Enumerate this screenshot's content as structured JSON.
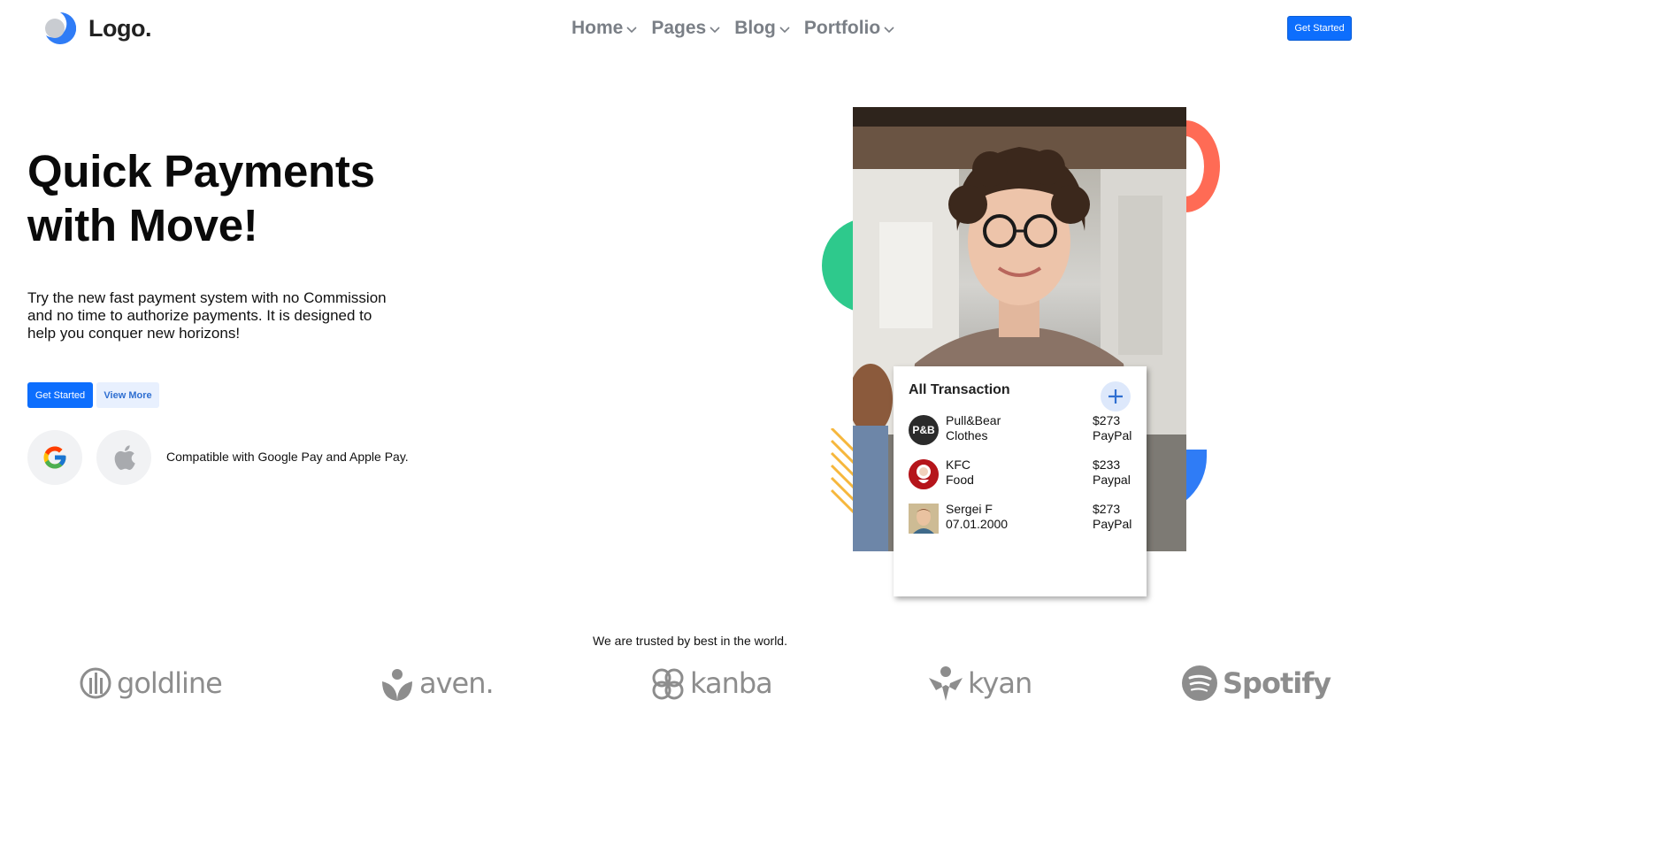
{
  "header": {
    "logo_text": "Logo.",
    "nav": [
      {
        "label": "Home"
      },
      {
        "label": "Pages"
      },
      {
        "label": "Blog"
      },
      {
        "label": "Portfolio"
      }
    ],
    "cta_label": "Get Started"
  },
  "hero": {
    "title_line1": "Quick Payments",
    "title_line2": "with Move!",
    "description": "Try the new fast payment system with no Commission and no time to authorize payments. It is designed to help you conquer new horizons!",
    "primary_button": "Get Started",
    "secondary_button": "View More",
    "compat_text": "Compatible with Google Pay and Apple Pay."
  },
  "card": {
    "title": "All Transaction",
    "transactions": [
      {
        "avatar": "P&B",
        "name": "Pull&Bear",
        "sub": "Clothes",
        "amount": "$273",
        "method": "PayPal"
      },
      {
        "avatar": "KFC",
        "name": "KFC",
        "sub": "Food",
        "amount": "$233",
        "method": "Paypal"
      },
      {
        "avatar": "",
        "name": "Sergei F",
        "sub": "07.01.2000",
        "amount": "$273",
        "method": "PayPal"
      }
    ]
  },
  "trusted": {
    "text": "We are trusted by best in the world.",
    "brands": [
      "goldline",
      "aven.",
      "kanba",
      "kyan",
      "Spotify"
    ]
  },
  "colors": {
    "primary": "#0d6efd",
    "accent_orange": "#ff6b55",
    "accent_green": "#2ec98c",
    "accent_blue": "#2f7cf6",
    "accent_yellow": "#f6b73c"
  }
}
